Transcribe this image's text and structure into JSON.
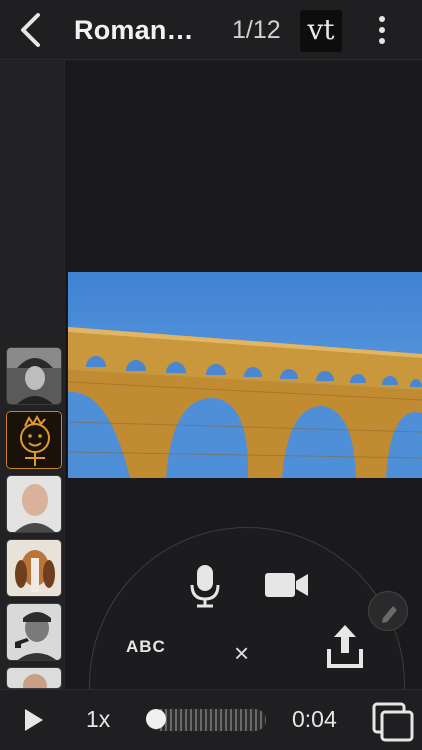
{
  "header": {
    "title": "Roman…",
    "page_indicator": "1/12",
    "logo_text": "vt"
  },
  "sidebar": {
    "thumbnails": [
      {
        "subject": "man-with-hat-bw"
      },
      {
        "subject": "child-drawing-face"
      },
      {
        "subject": "bald-man-portrait"
      },
      {
        "subject": "basset-hound"
      },
      {
        "subject": "man-with-pipe-bw"
      },
      {
        "subject": "partial-portrait"
      }
    ]
  },
  "slide": {
    "subject": "roman-aqueduct-photo",
    "colors": {
      "sky": "#4f8fd8",
      "stone": "#c9973c"
    }
  },
  "record_menu": {
    "text_label": "ABC",
    "close_label": "×"
  },
  "playback": {
    "speed": "1x",
    "time": "0:04",
    "progress": 0.0
  },
  "colors": {
    "background": "#1b1b1d",
    "bar": "#1f1f21"
  }
}
